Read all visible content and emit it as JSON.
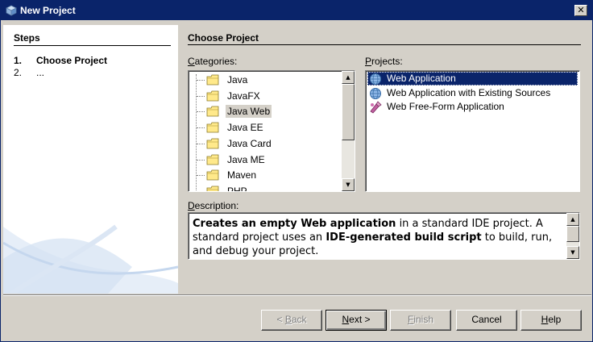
{
  "window": {
    "title": "New Project",
    "close_label": "✕"
  },
  "steps": {
    "title": "Steps",
    "items": [
      {
        "num": "1.",
        "label": "Choose Project"
      },
      {
        "num": "2.",
        "label": "..."
      }
    ]
  },
  "main": {
    "heading": "Choose Project",
    "categories_label": {
      "mnemonic": "C",
      "rest": "ategories:"
    },
    "projects_label": {
      "mnemonic": "P",
      "rest": "rojects:"
    },
    "description_label": {
      "mnemonic": "D",
      "rest": "escription:"
    }
  },
  "categories": [
    {
      "label": "Java"
    },
    {
      "label": "JavaFX"
    },
    {
      "label": "Java Web",
      "selected": true
    },
    {
      "label": "Java EE"
    },
    {
      "label": "Java Card"
    },
    {
      "label": "Java ME"
    },
    {
      "label": "Maven"
    },
    {
      "label": "PHP"
    }
  ],
  "projects": [
    {
      "label": "Web Application",
      "icon": "globe-icon",
      "selected": true
    },
    {
      "label": "Web Application with Existing Sources",
      "icon": "globe-icon"
    },
    {
      "label": "Web Free-Form Application",
      "icon": "freeform-icon"
    }
  ],
  "description": {
    "parts": [
      {
        "text": "Creates an empty Web application",
        "bold": true
      },
      {
        "text": " in a standard IDE project. A standard project uses an ",
        "bold": false
      },
      {
        "text": "IDE-generated build script",
        "bold": true
      },
      {
        "text": " to build, run, and debug your project.",
        "bold": false
      }
    ]
  },
  "buttons": {
    "back": {
      "label": "< Back",
      "disabled": true
    },
    "next": {
      "label": "Next >",
      "disabled": false
    },
    "finish": {
      "label": "Finish",
      "disabled": true
    },
    "cancel": {
      "label": "Cancel",
      "disabled": false
    },
    "help": {
      "label": "Help",
      "disabled": false
    }
  },
  "colors": {
    "selection": "#0a246a",
    "dialog_bg": "#d4d0c8",
    "folder": "#ffe98a"
  }
}
